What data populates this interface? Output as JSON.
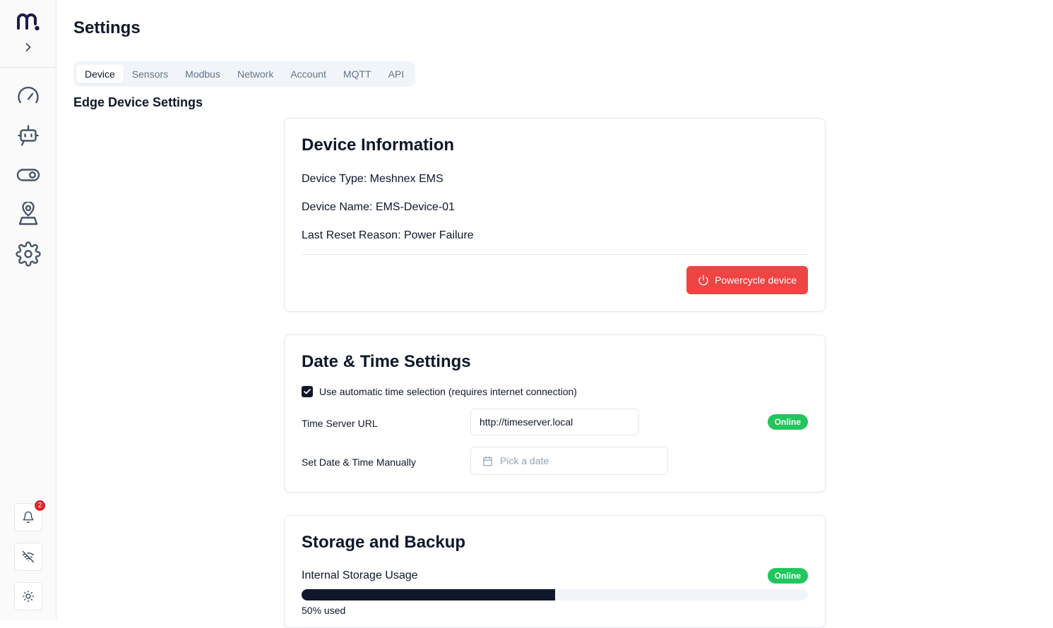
{
  "sidebar": {
    "notification_count": "2",
    "items": [
      {
        "name": "dashboard",
        "icon": "gauge-icon"
      },
      {
        "name": "devices",
        "icon": "bot-icon"
      },
      {
        "name": "controls",
        "icon": "toggle-icon"
      },
      {
        "name": "users",
        "icon": "user-location-icon"
      },
      {
        "name": "settings",
        "icon": "gear-icon"
      }
    ],
    "bottom": [
      "bell-icon",
      "wifi-off-icon",
      "sun-icon"
    ]
  },
  "page": {
    "title": "Settings",
    "tabs": [
      "Device",
      "Sensors",
      "Modbus",
      "Network",
      "Account",
      "MQTT",
      "API"
    ],
    "active_tab": "Device",
    "section_heading": "Edge Device Settings"
  },
  "device_info": {
    "title": "Device Information",
    "device_type": "Device Type: Meshnex EMS",
    "device_name": "Device Name: EMS-Device-01",
    "last_reset": "Last Reset Reason: Power Failure",
    "powercycle_label": "Powercycle device"
  },
  "datetime": {
    "title": "Date & Time Settings",
    "auto_label": "Use automatic time selection (requires internet connection)",
    "auto_checked": true,
    "time_server_label": "Time Server URL",
    "time_server_value": "http://timeserver.local",
    "time_server_status": "Online",
    "manual_label": "Set Date & Time Manually",
    "date_placeholder": "Pick a date"
  },
  "storage": {
    "title": "Storage and Backup",
    "usage_label": "Internal Storage Usage",
    "status": "Online",
    "usage_percent": 50,
    "usage_text": "50% used"
  },
  "colors": {
    "accent": "#0f172a",
    "danger": "#ef4444",
    "success": "#22c55e",
    "badge": "#dc2626"
  }
}
